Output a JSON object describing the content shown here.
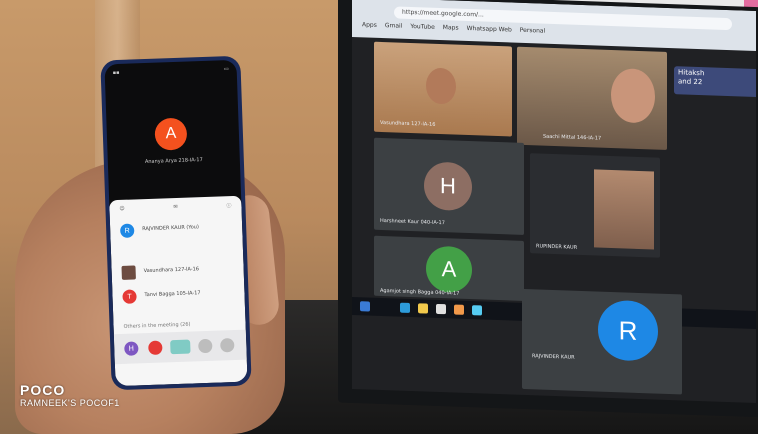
{
  "meet_screen": {
    "url": "https://meet.google.com/...",
    "bookmarks": [
      "Apps",
      "Gmail",
      "YouTube",
      "Maps",
      "Whatsapp Web",
      "Personal"
    ],
    "chat_notice_line1": "Hitaksh",
    "chat_notice_line2": "and 22",
    "tiles": [
      {
        "name": "Vasundhara 127-lA-16"
      },
      {
        "name": "Saachi Mittal 146-IA-17"
      },
      {
        "initial": "H",
        "name": "Harshneet Kaur 040-IA-17",
        "color": "#8d6e63"
      },
      {
        "name": "RUPINDER KAUR"
      },
      {
        "initial": "A",
        "name": "Agamjot singh Bagga 040-IA-17",
        "color": "#43a047"
      },
      {
        "initial": "R",
        "name": "RAJVINDER KAUR",
        "color": "#1e88e5"
      }
    ]
  },
  "phone": {
    "caller_initial": "A",
    "caller_name": "Ananya Arya 218-IA-17",
    "participants": [
      {
        "initial": "R",
        "name": "RAJVINDER KAUR (You)",
        "color": "#1e88e5"
      },
      {
        "initial": "",
        "name": "Vasundhara 127-lA-16",
        "color": "#6d4c41"
      },
      {
        "initial": "T",
        "name": "Tanvi Bagga 105-lA-17",
        "color": "#e53935"
      }
    ],
    "section_label": "Others in the meeting (26)",
    "bottom_initial": "H"
  },
  "watermark": {
    "brand": "POCO",
    "device": "RAMNEEK'S POCOF1"
  }
}
